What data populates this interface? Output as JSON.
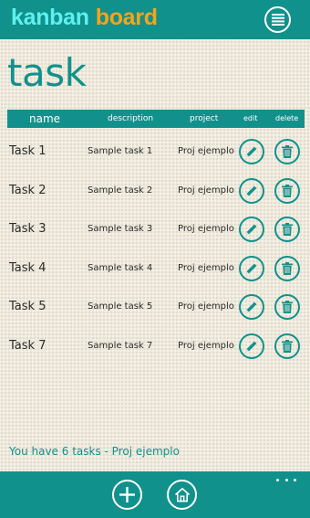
{
  "header": {
    "logo_word1": "kanban",
    "logo_word2": "board",
    "menu_icon": "hamburger-menu-icon"
  },
  "page": {
    "title": "task"
  },
  "table": {
    "columns": [
      "name",
      "description",
      "project",
      "edit",
      "delete"
    ],
    "rows": [
      {
        "name": "Task 1",
        "description": "Sample task 1",
        "project": "Proj ejemplo"
      },
      {
        "name": "Task 2",
        "description": "Sample task 2",
        "project": "Proj ejemplo"
      },
      {
        "name": "Task 3",
        "description": "Sample task 3",
        "project": "Proj ejemplo"
      },
      {
        "name": "Task 4",
        "description": "Sample task 4",
        "project": "Proj ejemplo"
      },
      {
        "name": "Task 5",
        "description": "Sample task 5",
        "project": "Proj ejemplo"
      },
      {
        "name": "Task 7",
        "description": "Sample task 7",
        "project": "Proj ejemplo"
      }
    ],
    "edit_icon": "pencil-icon",
    "delete_icon": "trash-icon"
  },
  "footer": {
    "summary": "You have 6 tasks - Proj ejemplo"
  },
  "app_bar": {
    "add_icon": "plus-icon",
    "home_icon": "home-icon",
    "more_icon": "ellipsis-icon"
  },
  "colors": {
    "accent": "#12918c",
    "logo_word1": "#5ff0f0",
    "logo_word2": "#f3a51d",
    "background": "#eeeadd"
  }
}
